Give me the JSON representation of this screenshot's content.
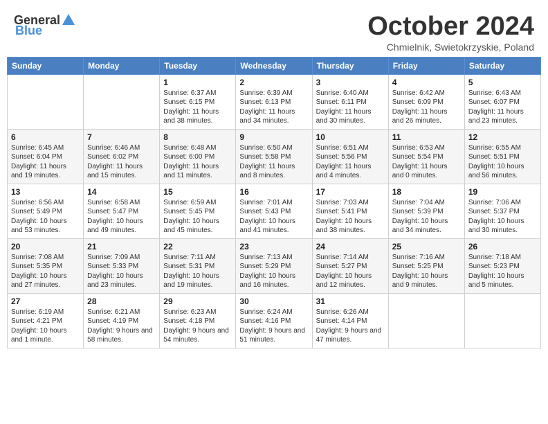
{
  "header": {
    "logo_general": "General",
    "logo_blue": "Blue",
    "month_title": "October 2024",
    "subtitle": "Chmielnik, Swietokrzyskie, Poland"
  },
  "weekdays": [
    "Sunday",
    "Monday",
    "Tuesday",
    "Wednesday",
    "Thursday",
    "Friday",
    "Saturday"
  ],
  "weeks": [
    [
      {
        "day": "",
        "info": ""
      },
      {
        "day": "",
        "info": ""
      },
      {
        "day": "1",
        "info": "Sunrise: 6:37 AM\nSunset: 6:15 PM\nDaylight: 11 hours and 38 minutes."
      },
      {
        "day": "2",
        "info": "Sunrise: 6:39 AM\nSunset: 6:13 PM\nDaylight: 11 hours and 34 minutes."
      },
      {
        "day": "3",
        "info": "Sunrise: 6:40 AM\nSunset: 6:11 PM\nDaylight: 11 hours and 30 minutes."
      },
      {
        "day": "4",
        "info": "Sunrise: 6:42 AM\nSunset: 6:09 PM\nDaylight: 11 hours and 26 minutes."
      },
      {
        "day": "5",
        "info": "Sunrise: 6:43 AM\nSunset: 6:07 PM\nDaylight: 11 hours and 23 minutes."
      }
    ],
    [
      {
        "day": "6",
        "info": "Sunrise: 6:45 AM\nSunset: 6:04 PM\nDaylight: 11 hours and 19 minutes."
      },
      {
        "day": "7",
        "info": "Sunrise: 6:46 AM\nSunset: 6:02 PM\nDaylight: 11 hours and 15 minutes."
      },
      {
        "day": "8",
        "info": "Sunrise: 6:48 AM\nSunset: 6:00 PM\nDaylight: 11 hours and 11 minutes."
      },
      {
        "day": "9",
        "info": "Sunrise: 6:50 AM\nSunset: 5:58 PM\nDaylight: 11 hours and 8 minutes."
      },
      {
        "day": "10",
        "info": "Sunrise: 6:51 AM\nSunset: 5:56 PM\nDaylight: 11 hours and 4 minutes."
      },
      {
        "day": "11",
        "info": "Sunrise: 6:53 AM\nSunset: 5:54 PM\nDaylight: 11 hours and 0 minutes."
      },
      {
        "day": "12",
        "info": "Sunrise: 6:55 AM\nSunset: 5:51 PM\nDaylight: 10 hours and 56 minutes."
      }
    ],
    [
      {
        "day": "13",
        "info": "Sunrise: 6:56 AM\nSunset: 5:49 PM\nDaylight: 10 hours and 53 minutes."
      },
      {
        "day": "14",
        "info": "Sunrise: 6:58 AM\nSunset: 5:47 PM\nDaylight: 10 hours and 49 minutes."
      },
      {
        "day": "15",
        "info": "Sunrise: 6:59 AM\nSunset: 5:45 PM\nDaylight: 10 hours and 45 minutes."
      },
      {
        "day": "16",
        "info": "Sunrise: 7:01 AM\nSunset: 5:43 PM\nDaylight: 10 hours and 41 minutes."
      },
      {
        "day": "17",
        "info": "Sunrise: 7:03 AM\nSunset: 5:41 PM\nDaylight: 10 hours and 38 minutes."
      },
      {
        "day": "18",
        "info": "Sunrise: 7:04 AM\nSunset: 5:39 PM\nDaylight: 10 hours and 34 minutes."
      },
      {
        "day": "19",
        "info": "Sunrise: 7:06 AM\nSunset: 5:37 PM\nDaylight: 10 hours and 30 minutes."
      }
    ],
    [
      {
        "day": "20",
        "info": "Sunrise: 7:08 AM\nSunset: 5:35 PM\nDaylight: 10 hours and 27 minutes."
      },
      {
        "day": "21",
        "info": "Sunrise: 7:09 AM\nSunset: 5:33 PM\nDaylight: 10 hours and 23 minutes."
      },
      {
        "day": "22",
        "info": "Sunrise: 7:11 AM\nSunset: 5:31 PM\nDaylight: 10 hours and 19 minutes."
      },
      {
        "day": "23",
        "info": "Sunrise: 7:13 AM\nSunset: 5:29 PM\nDaylight: 10 hours and 16 minutes."
      },
      {
        "day": "24",
        "info": "Sunrise: 7:14 AM\nSunset: 5:27 PM\nDaylight: 10 hours and 12 minutes."
      },
      {
        "day": "25",
        "info": "Sunrise: 7:16 AM\nSunset: 5:25 PM\nDaylight: 10 hours and 9 minutes."
      },
      {
        "day": "26",
        "info": "Sunrise: 7:18 AM\nSunset: 5:23 PM\nDaylight: 10 hours and 5 minutes."
      }
    ],
    [
      {
        "day": "27",
        "info": "Sunrise: 6:19 AM\nSunset: 4:21 PM\nDaylight: 10 hours and 1 minute."
      },
      {
        "day": "28",
        "info": "Sunrise: 6:21 AM\nSunset: 4:19 PM\nDaylight: 9 hours and 58 minutes."
      },
      {
        "day": "29",
        "info": "Sunrise: 6:23 AM\nSunset: 4:18 PM\nDaylight: 9 hours and 54 minutes."
      },
      {
        "day": "30",
        "info": "Sunrise: 6:24 AM\nSunset: 4:16 PM\nDaylight: 9 hours and 51 minutes."
      },
      {
        "day": "31",
        "info": "Sunrise: 6:26 AM\nSunset: 4:14 PM\nDaylight: 9 hours and 47 minutes."
      },
      {
        "day": "",
        "info": ""
      },
      {
        "day": "",
        "info": ""
      }
    ]
  ]
}
